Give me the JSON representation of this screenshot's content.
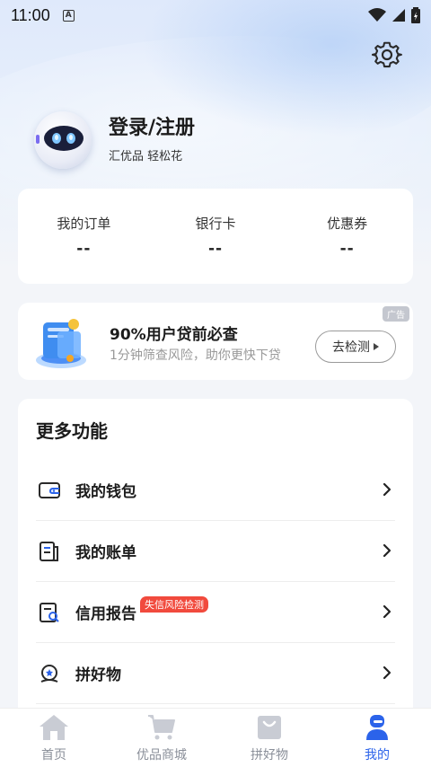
{
  "status_bar": {
    "time": "11:00"
  },
  "profile": {
    "title": "登录/注册",
    "subtitle": "汇优品 轻松花"
  },
  "stats": [
    {
      "label": "我的订单",
      "value": "--"
    },
    {
      "label": "银行卡",
      "value": "--"
    },
    {
      "label": "优惠券",
      "value": "--"
    }
  ],
  "ad": {
    "badge": "广告",
    "title": "90%用户贷前必查",
    "description": "1分钟筛查风险，助你更快下贷",
    "button": "去检测"
  },
  "more": {
    "title": "更多功能",
    "items": [
      {
        "label": "我的钱包",
        "icon": "wallet-icon"
      },
      {
        "label": "我的账单",
        "icon": "bill-icon"
      },
      {
        "label": "信用报告",
        "icon": "credit-report-icon",
        "tag": "失信风险检测"
      },
      {
        "label": "拼好物",
        "icon": "group-buy-icon"
      }
    ]
  },
  "nav": [
    {
      "label": "首页",
      "icon": "home-icon"
    },
    {
      "label": "优品商城",
      "icon": "cart-icon"
    },
    {
      "label": "拼好物",
      "icon": "bag-icon"
    },
    {
      "label": "我的",
      "icon": "user-icon",
      "active": true
    }
  ],
  "colors": {
    "accent": "#2b63ea",
    "tag_red": "#f14a3d",
    "inactive": "#c9ccd4"
  }
}
